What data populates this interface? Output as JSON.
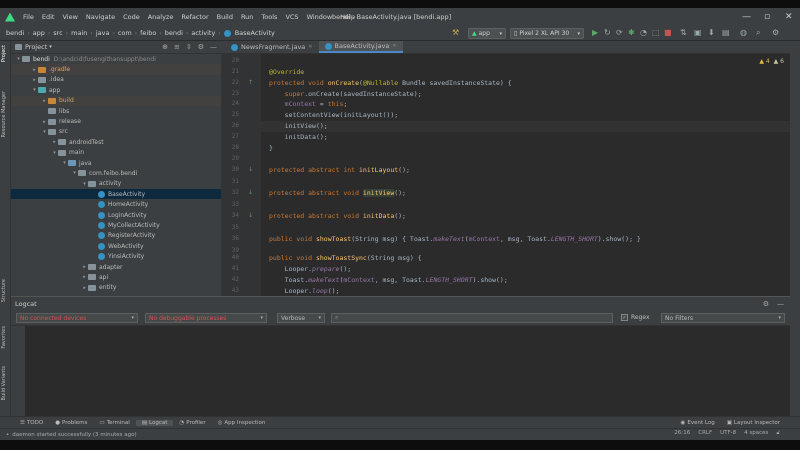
{
  "menu": [
    "File",
    "Edit",
    "View",
    "Navigate",
    "Code",
    "Analyze",
    "Refactor",
    "Build",
    "Run",
    "Tools",
    "VCS",
    "Window",
    "Help"
  ],
  "window_title": "bendi - BaseActivity.java [bendi.app]",
  "breadcrumbs": [
    "bendi",
    "app",
    "src",
    "main",
    "java",
    "com",
    "feibo",
    "bendi",
    "activity",
    "BaseActivity"
  ],
  "toolbar": {
    "run_config": "app",
    "device": "Pixel 2 XL API 30"
  },
  "left_tabs": [
    "Project",
    "Resource Manager",
    "Structure",
    "Favorites",
    "Build Variants"
  ],
  "project": {
    "title": "Project",
    "root_label": "bendi",
    "root_path": "D:\\andcid\\fusengithansuppt\\bendi",
    "tree": [
      {
        "label": ".gradle",
        "icon": "folder-orange",
        "arrow": "▸"
      },
      {
        "label": ".idea",
        "icon": "folder",
        "arrow": "▸"
      },
      {
        "label": "app",
        "icon": "folder-teal",
        "arrow": "▾"
      },
      {
        "label": "build",
        "icon": "folder-orange",
        "arrow": "▸"
      },
      {
        "label": "libs",
        "icon": "folder",
        "arrow": ""
      },
      {
        "label": "release",
        "icon": "folder",
        "arrow": "▸"
      },
      {
        "label": "src",
        "icon": "folder",
        "arrow": "▾"
      },
      {
        "label": "androidTest",
        "icon": "folder",
        "arrow": "▸"
      },
      {
        "label": "main",
        "icon": "folder",
        "arrow": "▾"
      },
      {
        "label": "java",
        "icon": "folder-blue",
        "arrow": "▾"
      },
      {
        "label": "com.feibo.bendi",
        "icon": "folder",
        "arrow": "▾"
      },
      {
        "label": "activity",
        "icon": "folder",
        "arrow": "▾"
      },
      {
        "label": "BaseActivity",
        "icon": "class",
        "arrow": ""
      },
      {
        "label": "HomeActivity",
        "icon": "class",
        "arrow": ""
      },
      {
        "label": "LoginActivity",
        "icon": "class",
        "arrow": ""
      },
      {
        "label": "MyCollectActivity",
        "icon": "class",
        "arrow": ""
      },
      {
        "label": "RegisterActivity",
        "icon": "class",
        "arrow": ""
      },
      {
        "label": "WebActivity",
        "icon": "class",
        "arrow": ""
      },
      {
        "label": "YinsiActivity",
        "icon": "class",
        "arrow": ""
      },
      {
        "label": "adapter",
        "icon": "folder",
        "arrow": "▸"
      },
      {
        "label": "api",
        "icon": "folder",
        "arrow": "▸"
      },
      {
        "label": "entity",
        "icon": "folder",
        "arrow": "▸"
      }
    ]
  },
  "editor_tabs": [
    {
      "label": "NewsFragment.java",
      "active": false
    },
    {
      "label": "BaseActivity.java",
      "active": true
    }
  ],
  "inspections": {
    "warnings": "▲ 4",
    "weak_warnings": "▲ 6"
  },
  "code_lines": [
    {
      "num": "20",
      "html": ""
    },
    {
      "num": "21",
      "html": "<span class=\"an\">@Override</span>"
    },
    {
      "num": "22",
      "html": "<span class=\"kw\">protected void </span><span class=\"fn\">onCreate</span>(<span class=\"an\">@Nullable</span> Bundle savedInstanceState) {"
    },
    {
      "num": "23",
      "html": "    <span class=\"kw\">super</span>.onCreate(savedInstanceState);"
    },
    {
      "num": "24",
      "html": "    <span class=\"fld\">mContext</span> = <span class=\"kw\">this</span>;"
    },
    {
      "num": "25",
      "html": "    setContentView(initLayout());"
    },
    {
      "num": "26",
      "html": "    initView();"
    },
    {
      "num": "27",
      "html": "    initData();"
    },
    {
      "num": "28",
      "html": "}"
    },
    {
      "num": "29",
      "html": ""
    },
    {
      "num": "30",
      "html": "<span class=\"kw\">protected abstract int </span><span class=\"fn\">initLayout</span>();"
    },
    {
      "num": "31",
      "html": ""
    },
    {
      "num": "32",
      "html": "<span class=\"kw\">protected abstract void </span><span class=\"fn hl\">initView</span>();"
    },
    {
      "num": "33",
      "html": ""
    },
    {
      "num": "34",
      "html": "<span class=\"kw\">protected abstract void </span><span class=\"fn\">initData</span>();"
    },
    {
      "num": "35",
      "html": ""
    },
    {
      "num": "36",
      "html": "<span class=\"kw\">public void </span><span class=\"fn\">showToast</span>(String msg) { Toast.<span class=\"it\">makeText</span>(<span class=\"fld\">mContext</span>, msg, Toast.<span class=\"it\">LENGTH_SHORT</span>).show(); }"
    },
    {
      "num": "39",
      "html": ""
    },
    {
      "num": "40",
      "html": "<span class=\"kw\">public void </span><span class=\"fn\">showToastSync</span>(String msg) {"
    },
    {
      "num": "41",
      "html": "    Looper.<span class=\"it\">prepare</span>();"
    },
    {
      "num": "42",
      "html": "    Toast.<span class=\"it\">makeText</span>(<span class=\"fld\">mContext</span>, msg, Toast.<span class=\"it\">LENGTH_SHORT</span>).show();"
    },
    {
      "num": "43",
      "html": "    Looper.<span class=\"it\">loop</span>();"
    }
  ],
  "logcat": {
    "title": "Logcat",
    "device_select": "No connected devices",
    "process_select": "No debuggable processes",
    "level_select": "Verbose",
    "search_placeholder": "",
    "regex_label": "Regex",
    "filter_select": "No Filters"
  },
  "bottom_tabs": [
    "TODO",
    "Problems",
    "Terminal",
    "Logcat",
    "Profiler",
    "App Inspection"
  ],
  "bottom_right_tabs": [
    "Event Log",
    "Layout Inspector"
  ],
  "status": {
    "message": "daemon started successfully (3 minutes ago)",
    "position": "26:16",
    "line_sep": "CRLF",
    "encoding": "UTF-8",
    "indent": "4 spaces"
  },
  "colors": {
    "accent": "#4a88c7",
    "bg_editor": "#2b2b2b",
    "bg_panel": "#3c3f41",
    "error_text": "#d25252"
  }
}
